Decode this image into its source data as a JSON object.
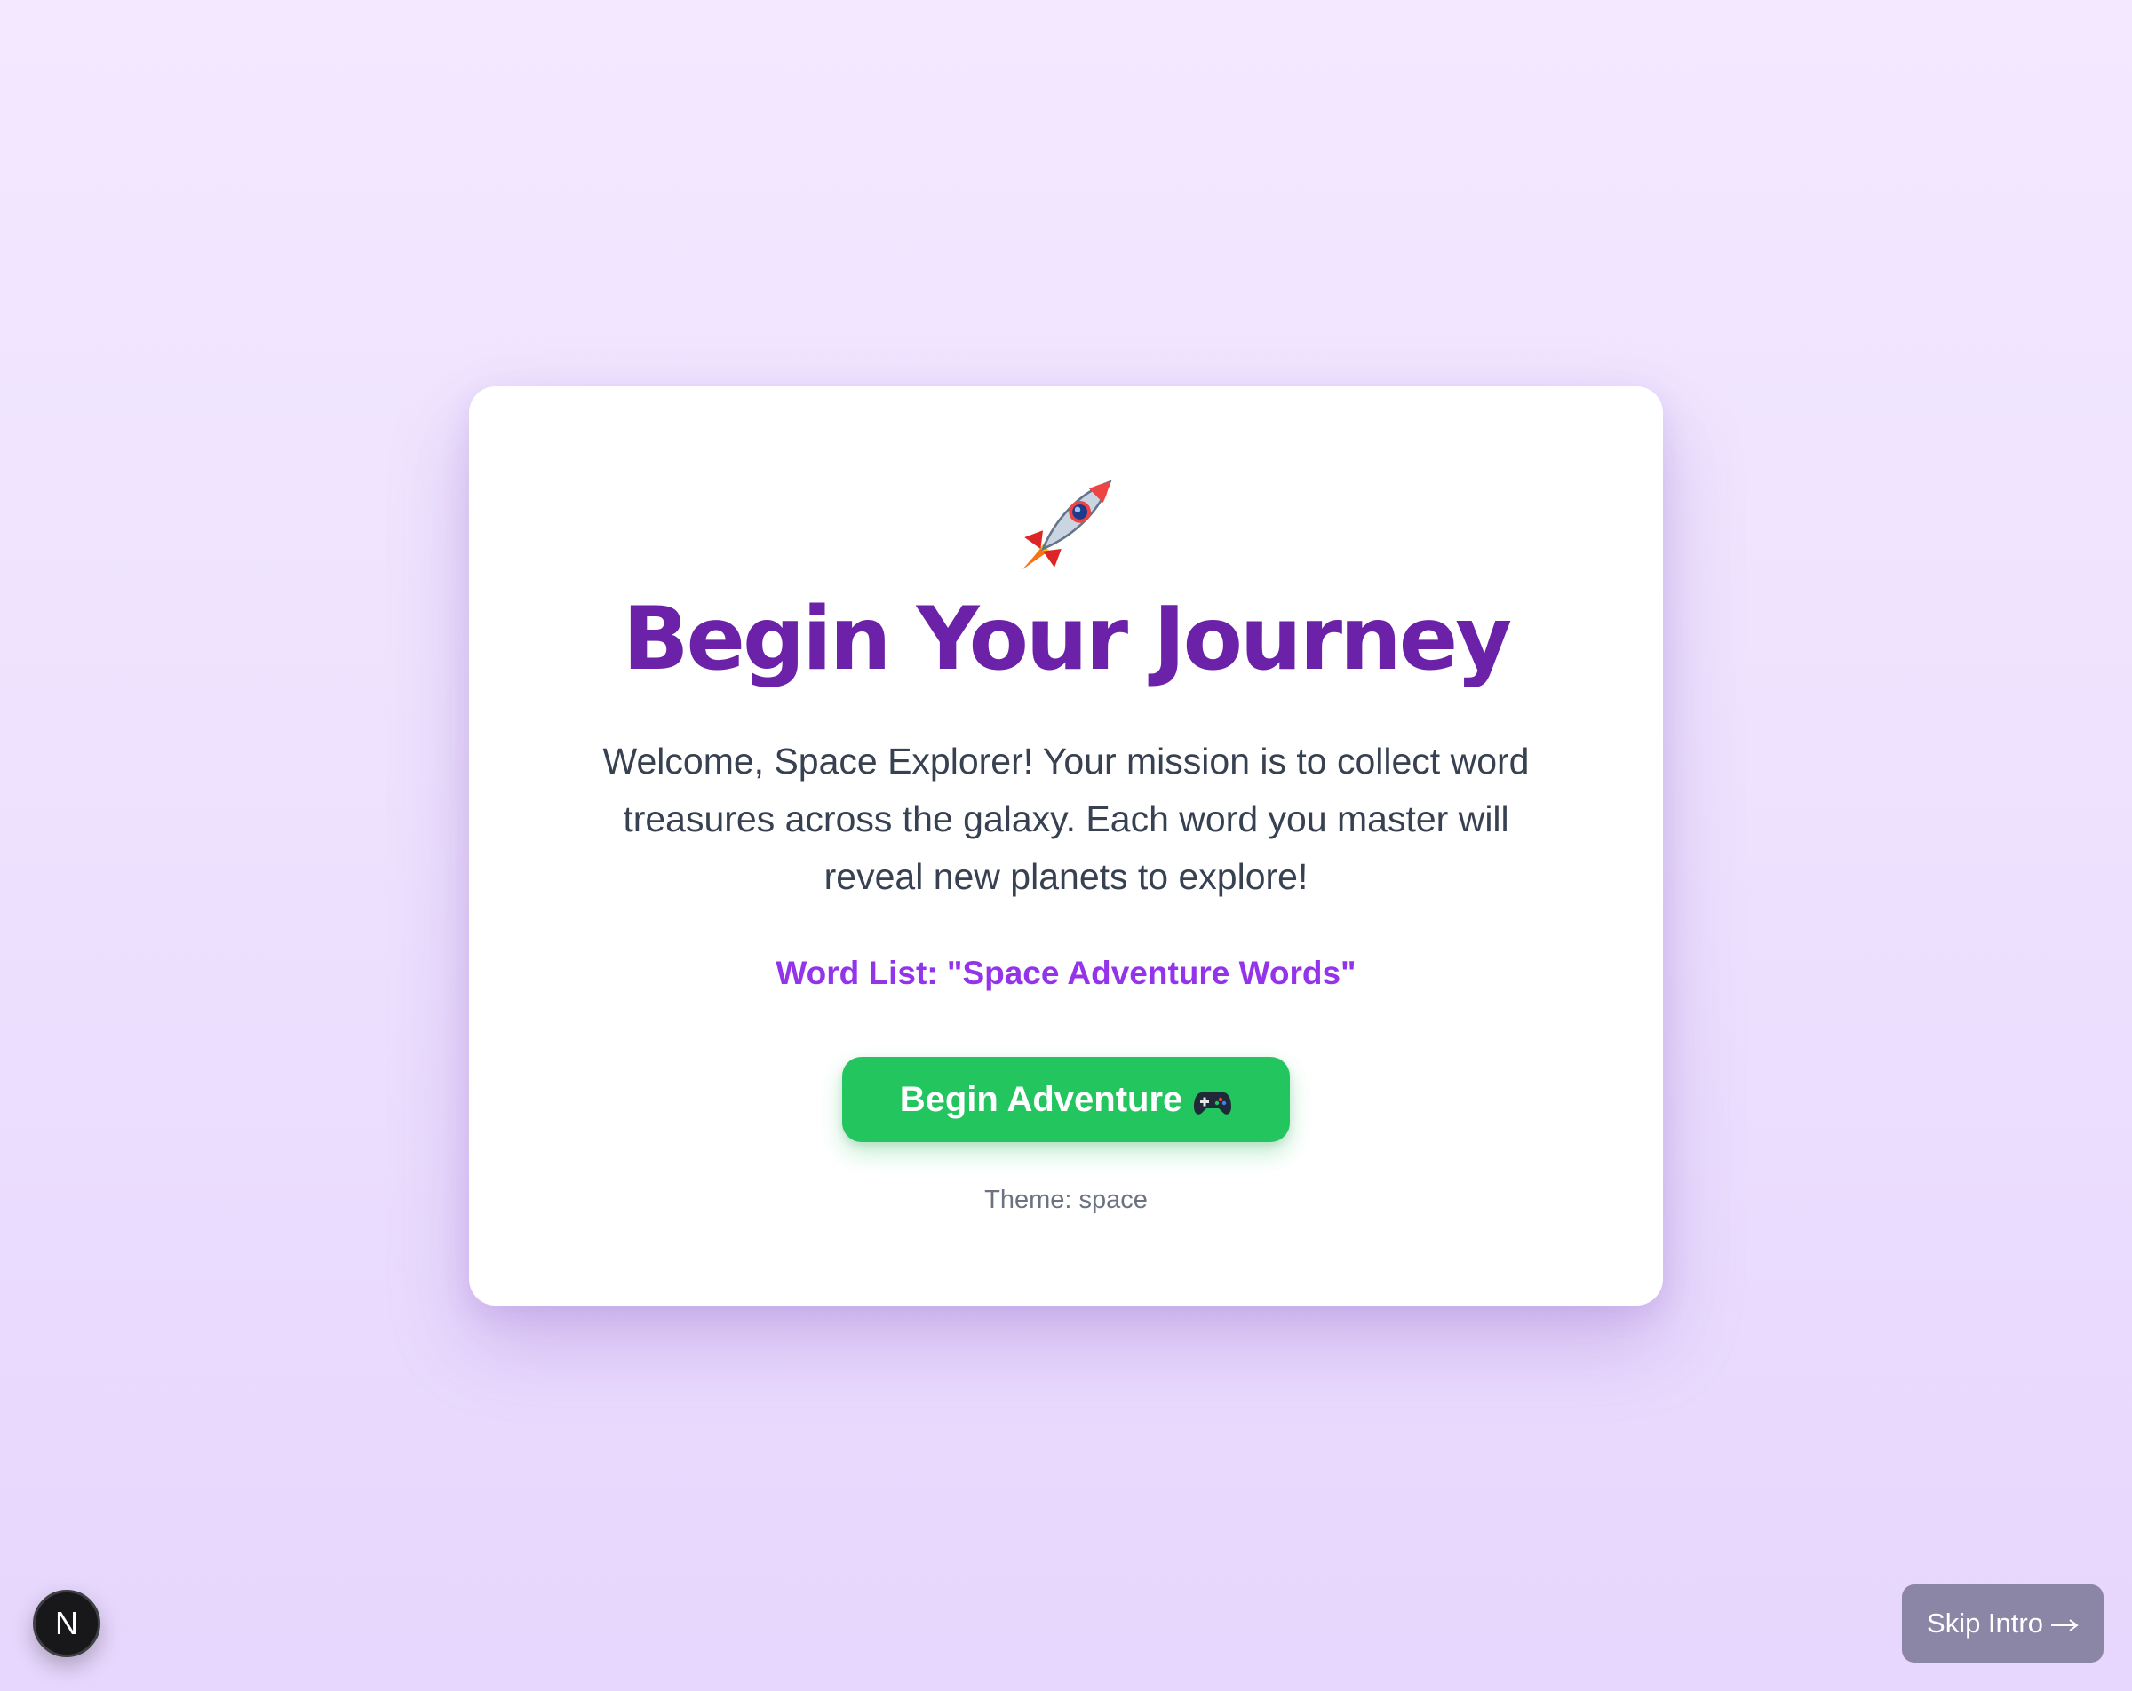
{
  "intro": {
    "icon": "rocket-icon",
    "title": "Begin Your Journey",
    "description": "Welcome, Space Explorer! Your mission is to collect word treasures across the galaxy. Each word you master will reveal new planets to explore!",
    "word_list_label": "Word List: \"Space Adventure Words\"",
    "begin_button_label": "Begin Adventure",
    "begin_button_icon": "gamepad-icon",
    "theme_label": "Theme: space"
  },
  "overlay": {
    "next_badge_letter": "N",
    "skip_button_label": "Skip Intro",
    "skip_button_icon": "arrow-right-icon"
  },
  "colors": {
    "background": "#f3e8ff",
    "title": "#6b21a8",
    "word_list": "#9333ea",
    "begin_button": "#22c55e",
    "skip_button": "#8b86a6"
  }
}
